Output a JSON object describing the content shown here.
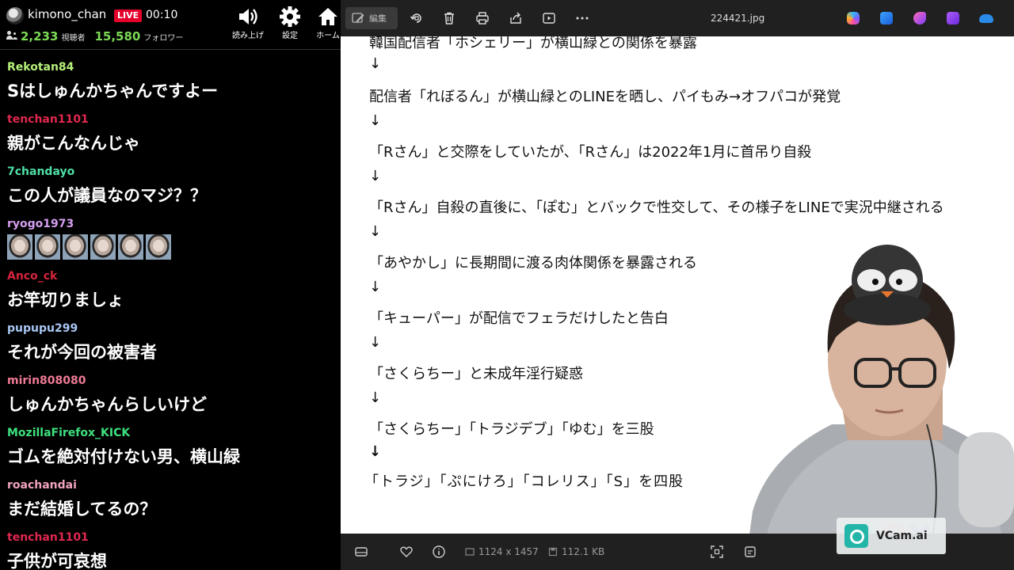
{
  "chat": {
    "channel": "kimono_chan",
    "live_label": "LIVE",
    "uptime": "00:10",
    "viewers": "2,233",
    "viewers_label": "視聴者",
    "followers": "15,580",
    "followers_label": "フォロワー",
    "buttons": {
      "read_aloud": "読み上げ",
      "settings": "設定",
      "home": "ホーム"
    },
    "messages": [
      {
        "user": "Rekotan84",
        "color": "#b5f07a",
        "text": "Sはしゅんかちゃんですよー"
      },
      {
        "user": "tenchan1101",
        "color": "#e0284f",
        "text": "親がこんなんじゃ"
      },
      {
        "user": "7chandayo",
        "color": "#4ee0a6",
        "text": "この人が議員なのマジ？？"
      },
      {
        "user": "ryogo1973",
        "color": "#d49ef0",
        "text": ""
      },
      {
        "user": "Anco_ck",
        "color": "#d6243c",
        "text": "お竿切りましょ"
      },
      {
        "user": "pupupu299",
        "color": "#a9c7f5",
        "text": "それが今回の被害者"
      },
      {
        "user": "mirin808080",
        "color": "#f07a95",
        "text": "しゅんかちゃんらしいけど"
      },
      {
        "user": "MozillaFirefox_KICK",
        "color": "#3ee07f",
        "text": "ゴムを絶対付けない男、横山緑"
      },
      {
        "user": "roachandai",
        "color": "#f0a3bf",
        "text": "まだ結婚してるの？"
      },
      {
        "user": "tenchan1101",
        "color": "#e0284f",
        "text": "子供が可哀想"
      }
    ]
  },
  "viewer": {
    "edit_label": "編集",
    "file_name": "224421.jpg",
    "document_lines": [
      "韓国配信者「ホシェリー」が横山緑との関係を暴露",
      "↓",
      "配信者「れぼるん」が横山緑とのLINEを晒し、パイもみ→オフパコが発覚",
      "↓",
      "「Rさん」と交際をしていたが、「Rさん」は2022年1月に首吊り自殺",
      "↓",
      "「Rさん」自殺の直後に、「ぽむ」とバックで性交して、その様子をLINEで実況中継される",
      "↓",
      "「あやかし」に長期間に渡る肉体関係を暴露される",
      "↓",
      "「キューパー」が配信でフェラだけしたと告白",
      "↓",
      "「さくらちー」と未成年淫行疑惑",
      "↓",
      "「さくらちー」「トラジデブ」「ゆむ」を三股",
      "↓",
      "「トラジ」「ぷにけろ」「コレリス」「S」を四股"
    ],
    "status": {
      "dimensions": "1124 x 1457",
      "file_size": "112.1 KB"
    }
  },
  "overlay": {
    "vcam": "VCam.ai"
  }
}
